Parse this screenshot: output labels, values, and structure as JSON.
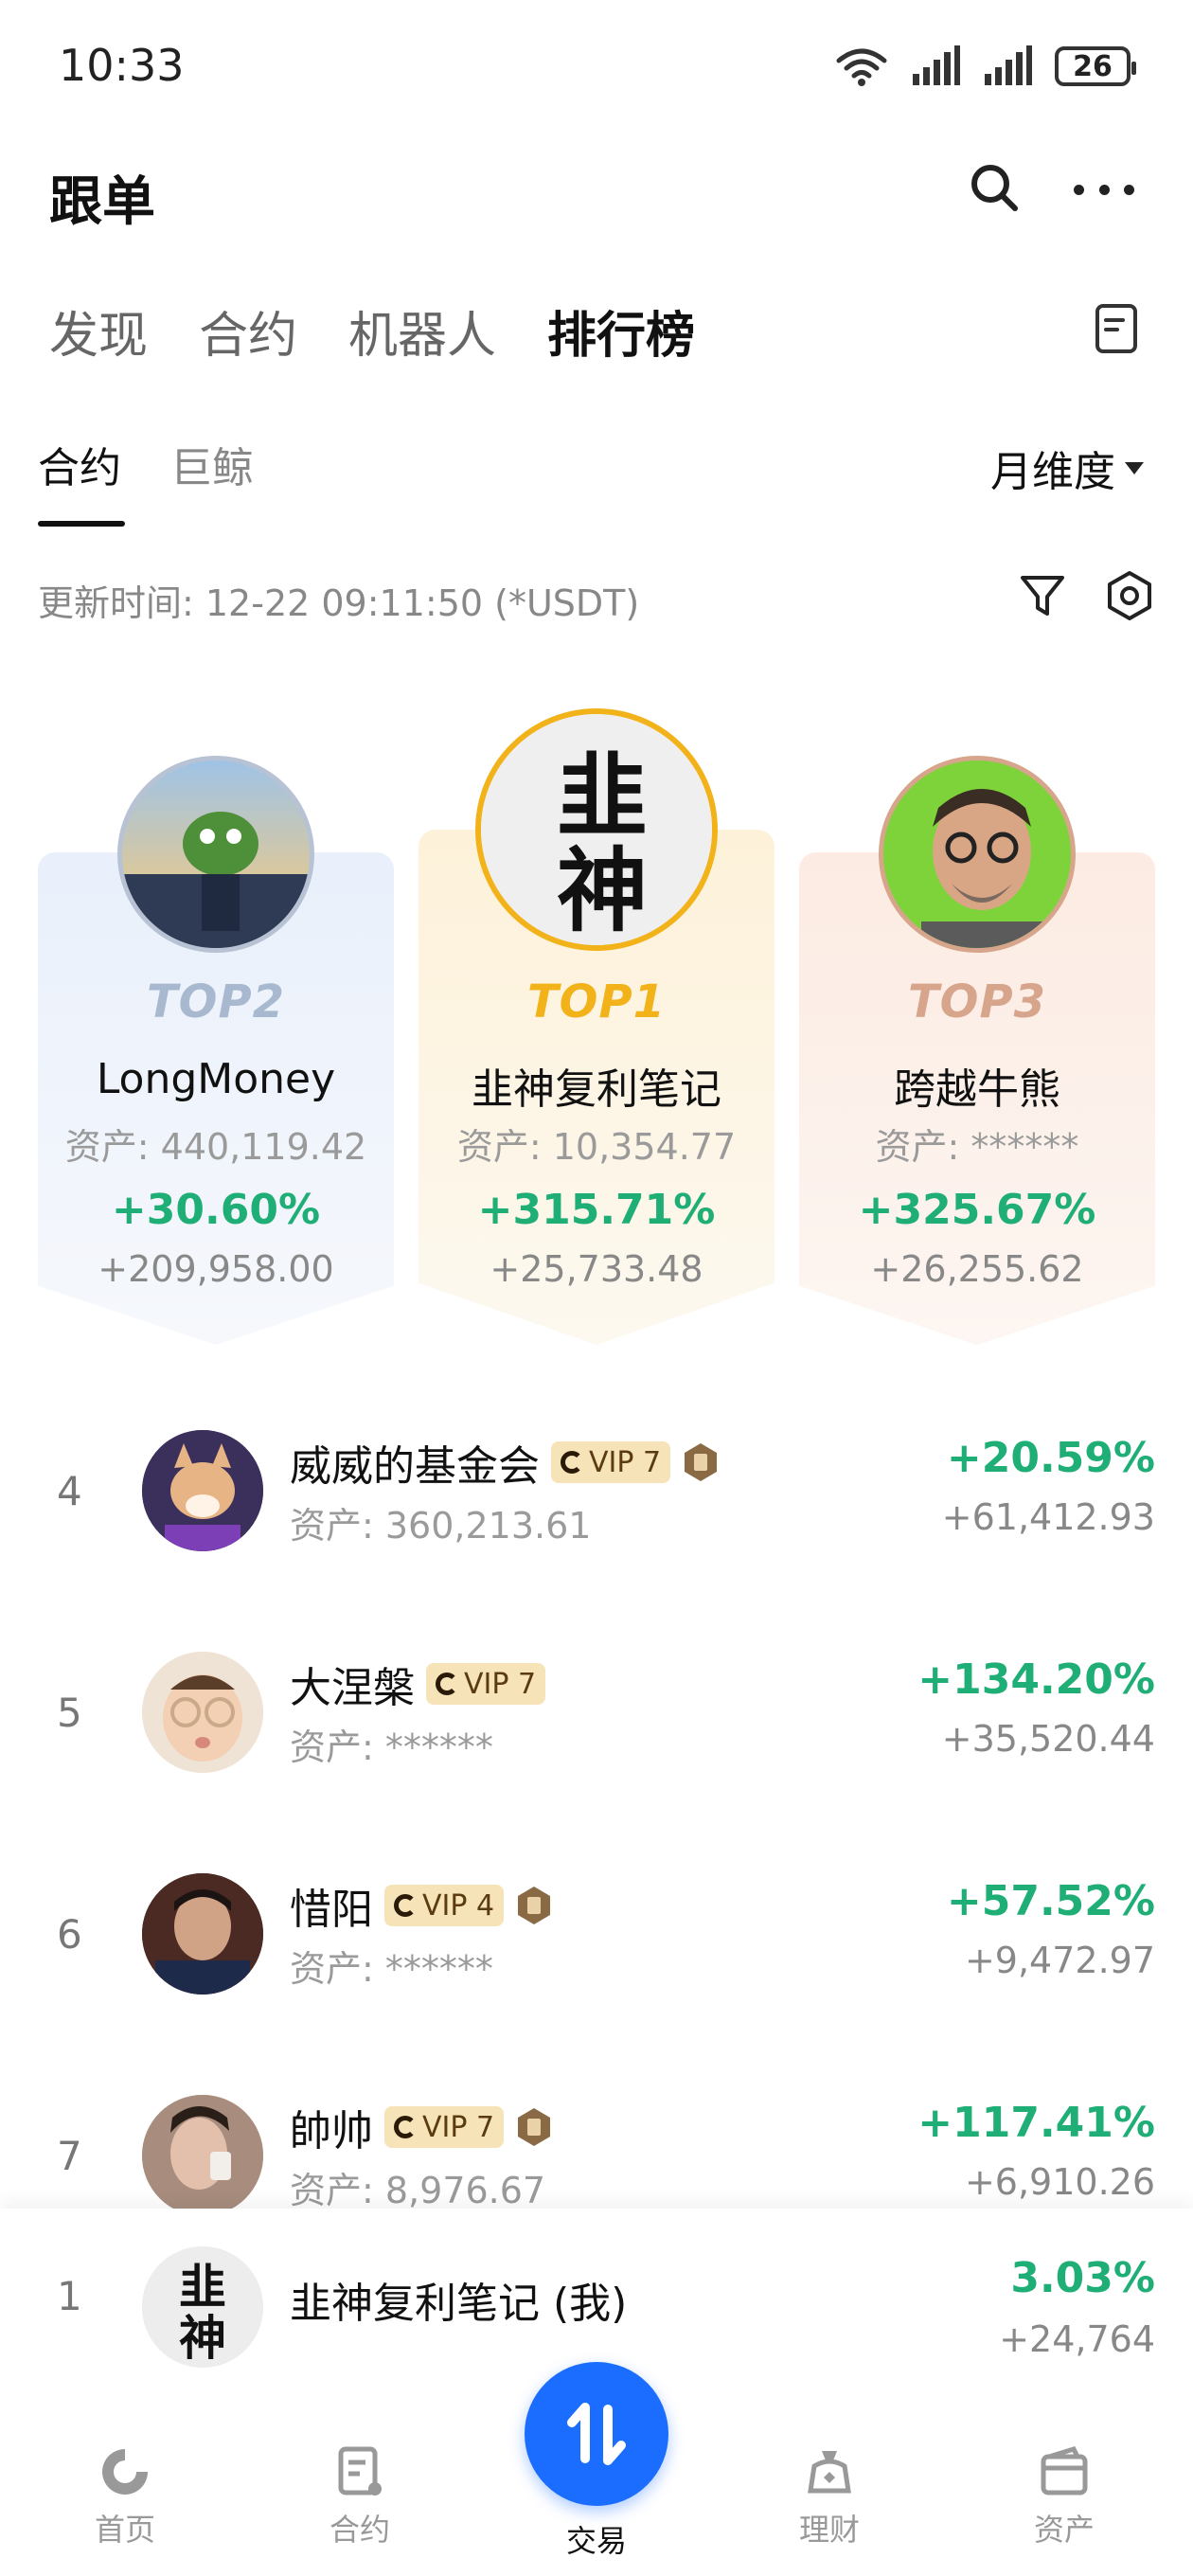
{
  "status_bar": {
    "time": "10:33",
    "battery": "26"
  },
  "header": {
    "title": "跟单"
  },
  "main_tabs": [
    {
      "label": "发现"
    },
    {
      "label": "合约"
    },
    {
      "label": "机器人"
    },
    {
      "label": "排行榜",
      "active": true
    }
  ],
  "sub_tabs": [
    {
      "label": "合约",
      "active": true
    },
    {
      "label": "巨鲸"
    }
  ],
  "period": "月维度",
  "update_time": "更新时间: 12-22 09:11:50 (*USDT)",
  "podium": [
    {
      "rank": "TOP2",
      "name": "LongMoney",
      "asset": "资产: 440,119.42",
      "pct": "+30.60%",
      "pnl": "+209,958.00",
      "rank_color": "#a8b9cf"
    },
    {
      "rank": "TOP1",
      "name": "韭神复利笔记",
      "asset": "资产: 10,354.77",
      "pct": "+315.71%",
      "pnl": "+25,733.48",
      "rank_color": "#f2b21a"
    },
    {
      "rank": "TOP3",
      "name": "跨越牛熊",
      "asset": "资产: ******",
      "pct": "+325.67%",
      "pnl": "+26,255.62",
      "rank_color": "#d7a58c"
    }
  ],
  "rows": [
    {
      "rank": "4",
      "name": "威威的基金会",
      "vip": "VIP 7",
      "medal": true,
      "asset": "资产: 360,213.61",
      "pct": "+20.59%",
      "pnl": "+61,412.93"
    },
    {
      "rank": "5",
      "name": "大涅槃",
      "vip": "VIP 7",
      "medal": false,
      "asset": "资产: ******",
      "pct": "+134.20%",
      "pnl": "+35,520.44"
    },
    {
      "rank": "6",
      "name": "惜阳",
      "vip": "VIP 4",
      "medal": true,
      "asset": "资产: ******",
      "pct": "+57.52%",
      "pnl": "+9,472.97"
    },
    {
      "rank": "7",
      "name": "帥帅",
      "vip": "VIP 7",
      "medal": true,
      "asset": "资产: 8,976.67",
      "pct": "+117.41%",
      "pnl": "+6,910.26"
    }
  ],
  "my_row": {
    "rank": "1",
    "name": "韭神复利笔记 (我)",
    "pct": "3.03%",
    "pnl": "+24,764"
  },
  "bottom_nav": [
    {
      "label": "首页",
      "icon": "home-icon"
    },
    {
      "label": "合约",
      "icon": "contract-icon"
    },
    {
      "label": "交易",
      "icon": "trade-icon",
      "active": true
    },
    {
      "label": "理财",
      "icon": "finance-icon"
    },
    {
      "label": "资产",
      "icon": "wallet-icon"
    }
  ],
  "colors": {
    "green": "#1fae76",
    "accent_blue": "#1a6dff"
  }
}
